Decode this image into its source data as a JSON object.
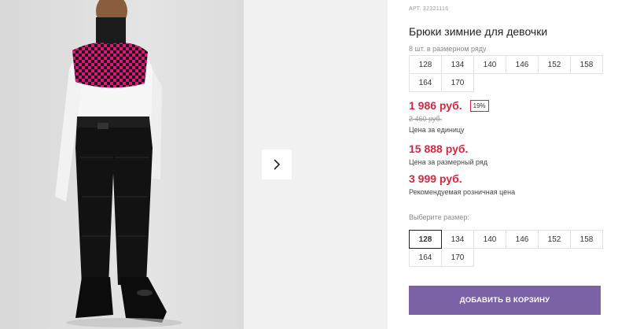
{
  "product": {
    "article_prefix": "АРТ.",
    "article": "32321116",
    "title": "Брюки зимние для девочки",
    "pack_note": "8 шт. в размерном ряду",
    "pack_sizes": [
      "128",
      "134",
      "140",
      "146",
      "152",
      "158",
      "164",
      "170"
    ]
  },
  "pricing": {
    "unit_price": "1 986 руб.",
    "discount": "19%",
    "old_price": "2 460 руб.",
    "unit_label": "Цена за единицу",
    "series_price": "15 888 руб.",
    "series_label": "Цена за размерный ряд",
    "rrp_price": "3 999 руб.",
    "rrp_label": "Рекомендуемая розничная цена"
  },
  "size_picker": {
    "label": "Выберите размер:",
    "selected": "128",
    "sizes": [
      "128",
      "134",
      "140",
      "146",
      "152",
      "158",
      "164",
      "170"
    ]
  },
  "cart": {
    "button_label": "ДОБАВИТЬ В КОРЗИНУ"
  },
  "colors": {
    "accent_price": "#d7263d",
    "cart_button": "#7b62a6",
    "scarf_pink": "#e3147a"
  },
  "icons": {
    "next": "chevron-right-icon"
  }
}
